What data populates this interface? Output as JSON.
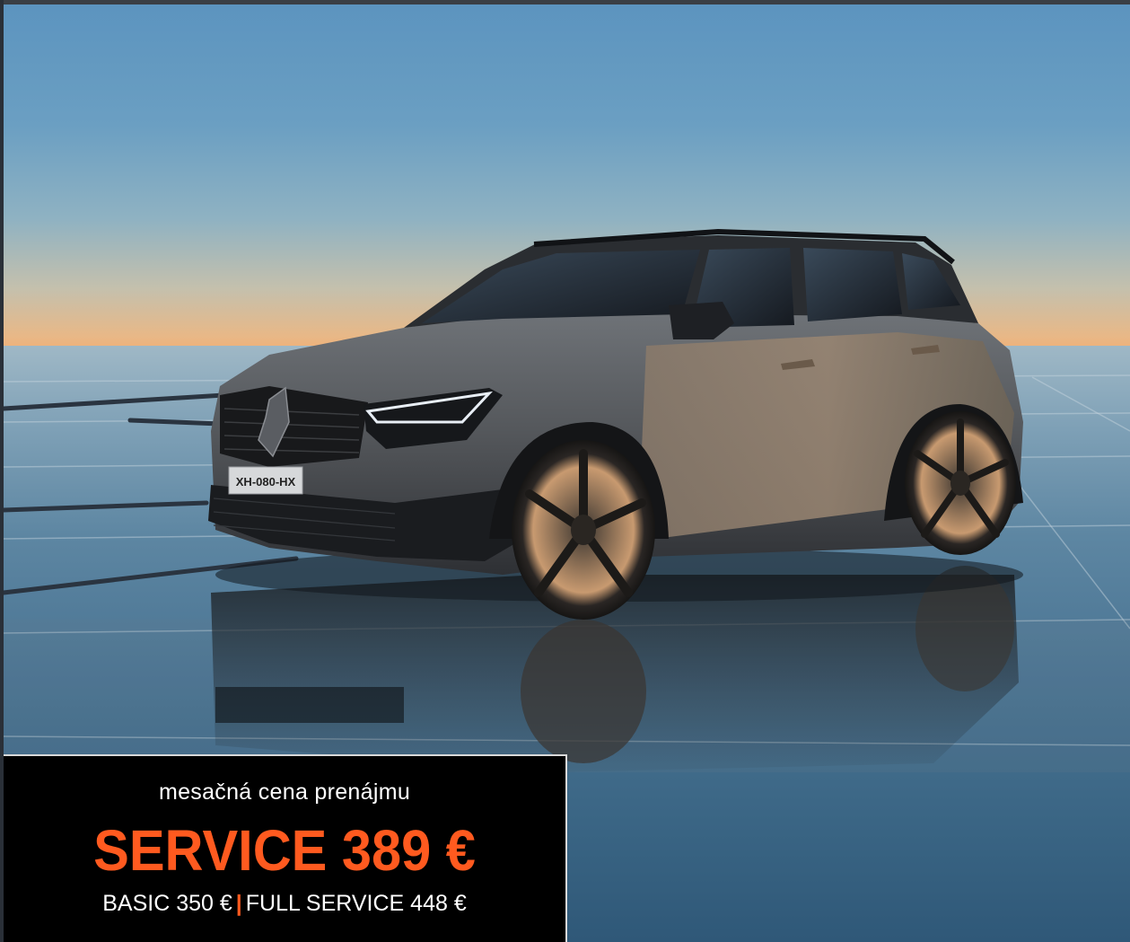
{
  "ad": {
    "car": {
      "license_plate": "XH-080-HX",
      "logo": "renault-diamond-icon"
    },
    "price_box": {
      "subtitle": "mesačná cena prenájmu",
      "main_price": "SERVICE 389 €",
      "options": [
        {
          "label": "BASIC 350 €"
        },
        {
          "label": "FULL SERVICE 448 €"
        }
      ],
      "separator": "|"
    },
    "colors": {
      "accent": "#ff5a1f",
      "box_background": "#000000",
      "text": "#ffffff"
    }
  }
}
